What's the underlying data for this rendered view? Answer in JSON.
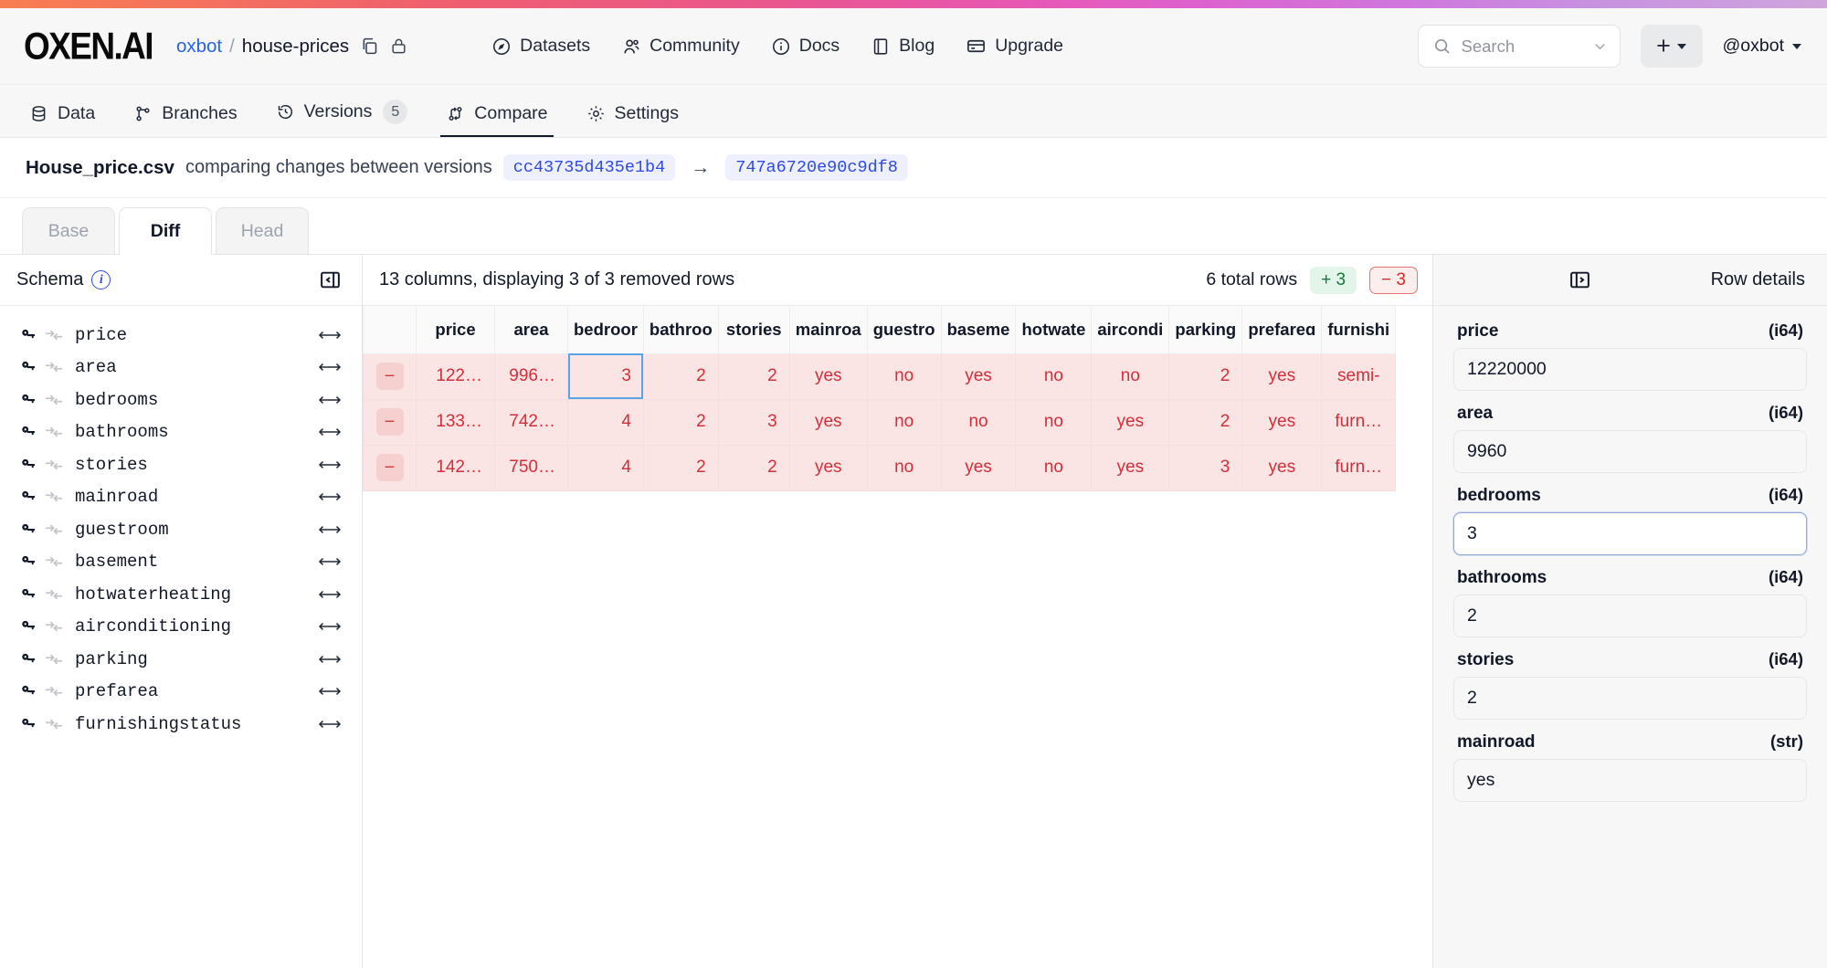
{
  "brand": {
    "logo": "OXEN.AI"
  },
  "breadcrumb": {
    "owner": "oxbot",
    "separator": "/",
    "repo": "house-prices"
  },
  "nav": {
    "links": [
      {
        "label": "Datasets",
        "icon": "compass-icon"
      },
      {
        "label": "Community",
        "icon": "people-icon"
      },
      {
        "label": "Docs",
        "icon": "info-circle-icon"
      },
      {
        "label": "Blog",
        "icon": "book-icon"
      },
      {
        "label": "Upgrade",
        "icon": "card-icon"
      }
    ],
    "search_placeholder": "Search",
    "add_label": "+",
    "user": "@oxbot"
  },
  "repo_tabs": [
    {
      "label": "Data",
      "icon": "database-icon",
      "active": false,
      "count": ""
    },
    {
      "label": "Branches",
      "icon": "branch-icon",
      "active": false,
      "count": ""
    },
    {
      "label": "Versions",
      "icon": "history-icon",
      "active": false,
      "count": "5"
    },
    {
      "label": "Compare",
      "icon": "compare-icon",
      "active": true,
      "count": ""
    },
    {
      "label": "Settings",
      "icon": "gear-icon",
      "active": false,
      "count": ""
    }
  ],
  "compare_header": {
    "filename": "House_price.csv",
    "description": "comparing changes between versions",
    "base_hash": "cc43735d435e1b4",
    "arrow": "→",
    "head_hash": "747a6720e90c9df8"
  },
  "diff_tabs": [
    {
      "label": "Base",
      "active": false
    },
    {
      "label": "Diff",
      "active": true
    },
    {
      "label": "Head",
      "active": false
    }
  ],
  "schema": {
    "title": "Schema",
    "info_glyph": "i",
    "fields": [
      {
        "name": "price"
      },
      {
        "name": "area"
      },
      {
        "name": "bedrooms"
      },
      {
        "name": "bathrooms"
      },
      {
        "name": "stories"
      },
      {
        "name": "mainroad"
      },
      {
        "name": "guestroom"
      },
      {
        "name": "basement"
      },
      {
        "name": "hotwaterheating"
      },
      {
        "name": "airconditioning"
      },
      {
        "name": "parking"
      },
      {
        "name": "prefarea"
      },
      {
        "name": "furnishingstatus"
      }
    ]
  },
  "table_header": {
    "summary": "13 columns, displaying 3 of 3 removed rows",
    "total_rows": "6 total rows",
    "added_badge": "+ 3",
    "removed_badge": "− 3"
  },
  "table": {
    "columns": [
      "price",
      "area",
      "bedroor",
      "bathroo",
      "stories",
      "mainroa",
      "guestro",
      "baseme",
      "hotwate",
      "aircondi",
      "parking",
      "prefareɑ",
      "furnishi"
    ],
    "rows": [
      {
        "marker": "−",
        "cells": [
          "122…",
          "996…",
          "3",
          "2",
          "2",
          "yes",
          "no",
          "yes",
          "no",
          "no",
          "2",
          "yes",
          "semi-"
        ]
      },
      {
        "marker": "−",
        "cells": [
          "133…",
          "742…",
          "4",
          "2",
          "3",
          "yes",
          "no",
          "no",
          "no",
          "yes",
          "2",
          "yes",
          "furn…"
        ]
      },
      {
        "marker": "−",
        "cells": [
          "142…",
          "750…",
          "4",
          "2",
          "2",
          "yes",
          "no",
          "yes",
          "no",
          "yes",
          "3",
          "yes",
          "furn…"
        ]
      }
    ],
    "selected_cell": {
      "row": 0,
      "col": 2
    }
  },
  "row_details": {
    "title": "Row details",
    "fields": [
      {
        "name": "price",
        "type": "(i64)",
        "value": "12220000",
        "focused": false
      },
      {
        "name": "area",
        "type": "(i64)",
        "value": "9960",
        "focused": false
      },
      {
        "name": "bedrooms",
        "type": "(i64)",
        "value": "3",
        "focused": true
      },
      {
        "name": "bathrooms",
        "type": "(i64)",
        "value": "2",
        "focused": false
      },
      {
        "name": "stories",
        "type": "(i64)",
        "value": "2",
        "focused": false
      },
      {
        "name": "mainroad",
        "type": "(str)",
        "value": "yes",
        "focused": false
      }
    ]
  },
  "colors": {
    "accent_blue": "#2563eb",
    "hash_blue": "#2f4ae0",
    "removed_red": "#d32f3a",
    "removed_bg": "#fbe4e4",
    "added_green": "#137a37",
    "selection_blue": "#5ba4e5"
  }
}
